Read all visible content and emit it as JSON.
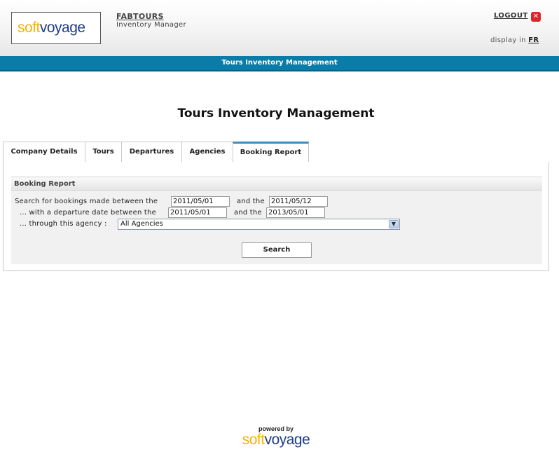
{
  "header": {
    "logo_soft": "soft",
    "logo_voyage": "voyage",
    "company": "FABTOURS",
    "subtitle": "Inventory Manager",
    "logout": "LOGOUT",
    "close_glyph": "✕",
    "display_in": "display in",
    "lang": "FR"
  },
  "bar": {
    "title": "Tours Inventory Management"
  },
  "page_title": "Tours Inventory Management",
  "tabs": [
    {
      "label": "Company Details"
    },
    {
      "label": "Tours"
    },
    {
      "label": "Departures"
    },
    {
      "label": "Agencies"
    },
    {
      "label": "Booking Report",
      "active": true
    }
  ],
  "report": {
    "section_title": "Booking Report",
    "row1_label": "Search for bookings made between the",
    "row1_from": "2011/05/01",
    "row1_and": "and the",
    "row1_to": "2011/05/12",
    "row2_label": "... with a departure date between the",
    "row2_from": "2011/05/01",
    "row2_and": "and the",
    "row2_to": "2013/05/01",
    "row3_label": "... through this agency :",
    "agency_selected": "All Agencies",
    "search_button": "Search"
  },
  "footer": {
    "powered_by": "powered by",
    "logo_soft": "soft",
    "logo_voyage": "voyage"
  },
  "colors": {
    "bar": "#0a7ca8",
    "logo_soft": "#f2b300",
    "logo_voyage": "#1f3d8c",
    "logout_icon": "#d8262b"
  }
}
